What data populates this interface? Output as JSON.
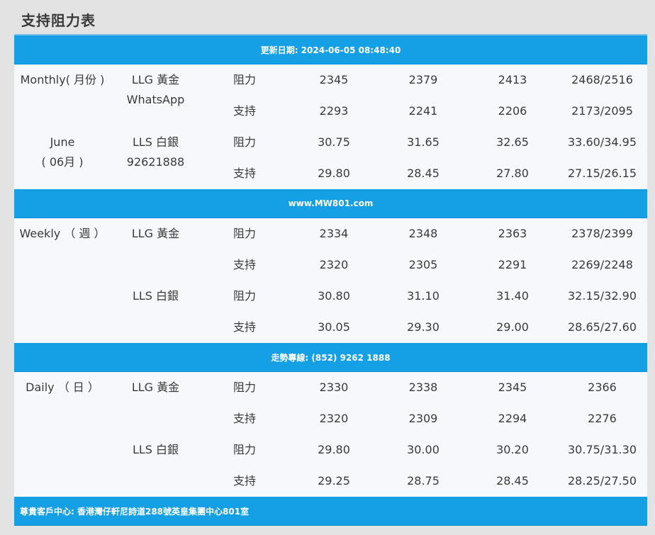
{
  "page_title": "支持阻力表",
  "update_banner": "更新日期: 2024-06-05 08:48:40",
  "website_banner": "www.MW801.com",
  "hotline_banner": "走勢專線: (852) 9262 1888",
  "footer_banner": "尊貴客戶中心: 香港灣仔軒尼詩道288號英皇集團中心801室",
  "monthly": {
    "period_line1": "Monthly( 月份 )",
    "period_line2": "June",
    "period_line3": "( 06月 )",
    "gold_label": "LLG 黃金",
    "gold_sub": "WhatsApp",
    "silver_label": "LLS 白銀",
    "silver_sub": "92621888",
    "rows": [
      {
        "type": "阻力",
        "v1": "2345",
        "v2": "2379",
        "v3": "2413",
        "v4": "2468/2516"
      },
      {
        "type": "支持",
        "v1": "2293",
        "v2": "2241",
        "v3": "2206",
        "v4": "2173/2095"
      },
      {
        "type": "阻力",
        "v1": "30.75",
        "v2": "31.65",
        "v3": "32.65",
        "v4": "33.60/34.95"
      },
      {
        "type": "支持",
        "v1": "29.80",
        "v2": "28.45",
        "v3": "27.80",
        "v4": "27.15/26.15"
      }
    ]
  },
  "weekly": {
    "period_line1": "Weekly （ 週 ）",
    "gold_label": "LLG 黃金",
    "silver_label": "LLS 白銀",
    "rows": [
      {
        "type": "阻力",
        "v1": "2334",
        "v2": "2348",
        "v3": "2363",
        "v4": "2378/2399"
      },
      {
        "type": "支持",
        "v1": "2320",
        "v2": "2305",
        "v3": "2291",
        "v4": "2269/2248"
      },
      {
        "type": "阻力",
        "v1": "30.80",
        "v2": "31.10",
        "v3": "31.40",
        "v4": "32.15/32.90"
      },
      {
        "type": "支持",
        "v1": "30.05",
        "v2": "29.30",
        "v3": "29.00",
        "v4": "28.65/27.60"
      }
    ]
  },
  "daily": {
    "period_line1": "Daily （ 日 ）",
    "gold_label": "LLG 黃金",
    "silver_label": "LLS 白銀",
    "rows": [
      {
        "type": "阻力",
        "v1": "2330",
        "v2": "2338",
        "v3": "2345",
        "v4": "2366"
      },
      {
        "type": "支持",
        "v1": "2320",
        "v2": "2309",
        "v3": "2294",
        "v4": "2276"
      },
      {
        "type": "阻力",
        "v1": "29.80",
        "v2": "30.00",
        "v3": "30.20",
        "v4": "30.75/31.30"
      },
      {
        "type": "支持",
        "v1": "29.25",
        "v2": "28.75",
        "v3": "28.45",
        "v4": "28.25/27.50"
      }
    ]
  },
  "colors": {
    "band": "#15a0e6",
    "section_bg": "#f6f8fb",
    "page_bg": "#e3e3e3",
    "text": "#3a3a3a"
  }
}
